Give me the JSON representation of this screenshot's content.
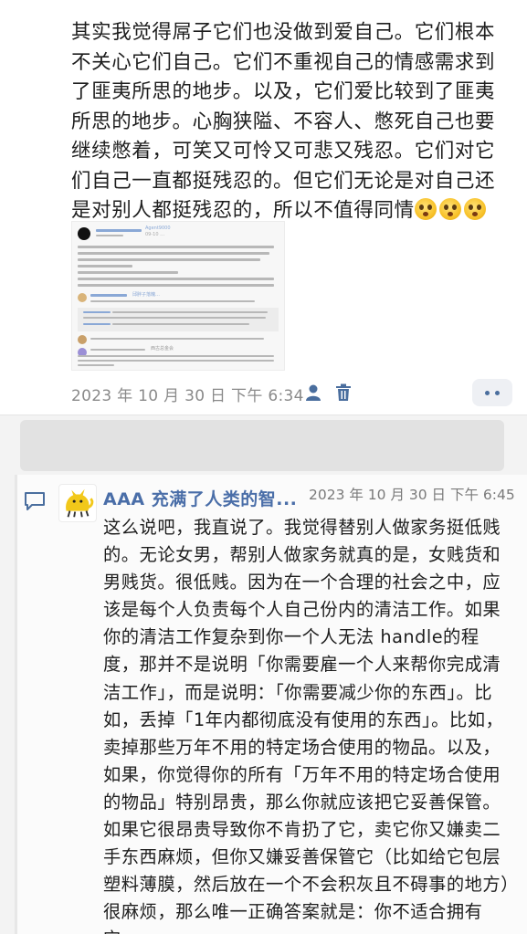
{
  "post1": {
    "text": "其实我觉得屌子它们也没做到爱自己。它们根本不关心它们自己。它们不重视自己的情感需求到了匪夷所思的地步。以及，它们爱比较到了匪夷所思的地步。心胸狭隘、不容人、憋死自己也要继续憋着，可笑又可怜又可悲又残忍。它们对它们自己一直都挺残忍的。但它们无论是对自己还是对别人都挺残忍的，所以不值得同情",
    "emoji_count": 3,
    "emoji_icon": "flushed-face-icon",
    "attachment": {
      "username": "Agent9000",
      "date": "09-10 …",
      "comment1_author": "邱胖子落魄…",
      "comment_author2": "西古总金会"
    },
    "timestamp": "2023 年 10 月 30 日  下午 6:34",
    "icons": [
      "user-icon",
      "trash-icon",
      "more-icon"
    ]
  },
  "reply": {
    "author": "AAA 充满了人类的智...",
    "timestamp": "2023 年 10 月 30 日  下午 6:45",
    "text": "这么说吧，我直说了。我觉得替别人做家务挺低贱的。无论女男，帮别人做家务就真的是，女贱货和男贱货。很低贱。因为在一个合理的社会之中，应该是每个人负责每个人自己份内的清洁工作。如果你的清洁工作复杂到你一个人无法 handle的程度，那并不是说明「你需要雇一个人来帮你完成清洁工作」，而是说明：「你需要减少你的东西」。比如，丢掉「1年内都彻底没有使用的东西」。比如，卖掉那些万年不用的特定场合使用的物品。以及，如果，你觉得你的所有「万年不用的特定场合使用的物品」特别昂贵，那么你就应该把它妥善保管。如果它很昂贵导致你不肯扔了它，卖它你又嫌卖二手东西麻烦，但你又嫌妥善保管它（比如给它包层塑料薄膜，然后放在一个不会积灰且不碍事的地方）很麻烦，那么唯一正确答案就是：你不适合拥有它。",
    "icons": [
      "reply-icon",
      "avatar-cat-logo"
    ]
  },
  "colors": {
    "link_blue": "#4a6ea8",
    "meta_gray": "#8a8a8a",
    "thread_bg": "#f3f3f3"
  }
}
